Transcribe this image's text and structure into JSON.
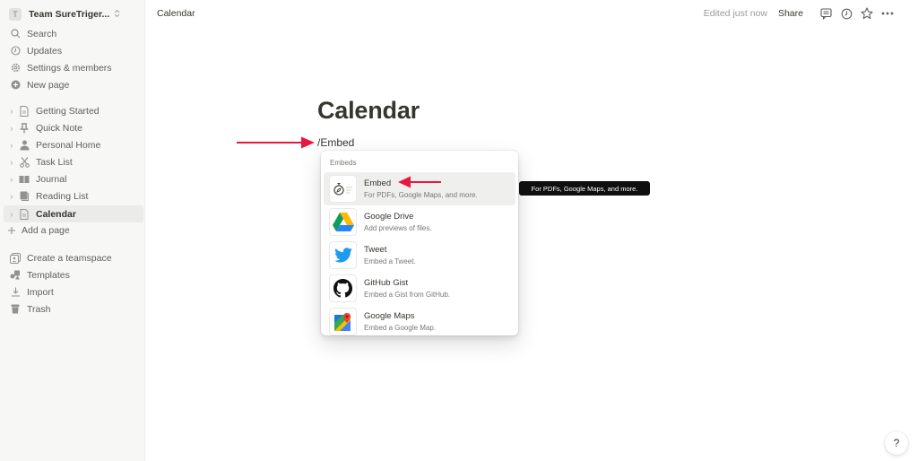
{
  "sidebar": {
    "workspace": {
      "avatar_letter": "T",
      "name": "Team SureTriger...",
      "chevron": "⌃⌄"
    },
    "top_items": [
      {
        "icon": "search-icon",
        "label": "Search"
      },
      {
        "icon": "clock-icon",
        "label": "Updates"
      },
      {
        "icon": "gear-icon",
        "label": "Settings & members"
      },
      {
        "icon": "plus-circle-icon",
        "label": "New page"
      }
    ],
    "pages": [
      {
        "icon": "document-icon",
        "label": "Getting Started"
      },
      {
        "icon": "pushpin-icon",
        "label": "Quick Note"
      },
      {
        "icon": "person-icon",
        "label": "Personal Home"
      },
      {
        "icon": "scissors-icon",
        "label": "Task List"
      },
      {
        "icon": "book-icon",
        "label": "Journal"
      },
      {
        "icon": "book-closed-icon",
        "label": "Reading List"
      },
      {
        "icon": "document-icon",
        "label": "Calendar",
        "active": true
      }
    ],
    "add_page": "Add a page",
    "bottom_items": [
      {
        "icon": "teamspace-icon",
        "label": "Create a teamspace"
      },
      {
        "icon": "templates-icon",
        "label": "Templates"
      },
      {
        "icon": "import-icon",
        "label": "Import"
      },
      {
        "icon": "trash-icon",
        "label": "Trash"
      }
    ]
  },
  "topbar": {
    "breadcrumb": "Calendar",
    "edited": "Edited just now",
    "share": "Share",
    "icons": [
      "comment-icon",
      "history-icon",
      "star-icon",
      "more-icon"
    ]
  },
  "page": {
    "title": "Calendar",
    "command_text": "/Embed"
  },
  "menu": {
    "header": "Embeds",
    "items": [
      {
        "title": "Embed",
        "desc": "For PDFs, Google Maps, and more.",
        "icon": "embed-compass-icon",
        "selected": true
      },
      {
        "title": "Google Drive",
        "desc": "Add previews of files.",
        "icon": "google-drive-icon"
      },
      {
        "title": "Tweet",
        "desc": "Embed a Tweet.",
        "icon": "twitter-icon"
      },
      {
        "title": "GitHub Gist",
        "desc": "Embed a Gist from GitHub.",
        "icon": "github-icon"
      },
      {
        "title": "Google Maps",
        "desc": "Embed a Google Map.",
        "icon": "google-maps-icon"
      }
    ]
  },
  "tooltip": "For PDFs, Google Maps, and more.",
  "help": "?",
  "colors": {
    "annotation_arrow": "#e8173f",
    "sidebar_bg": "#f7f7f5",
    "text": "#37352f"
  }
}
